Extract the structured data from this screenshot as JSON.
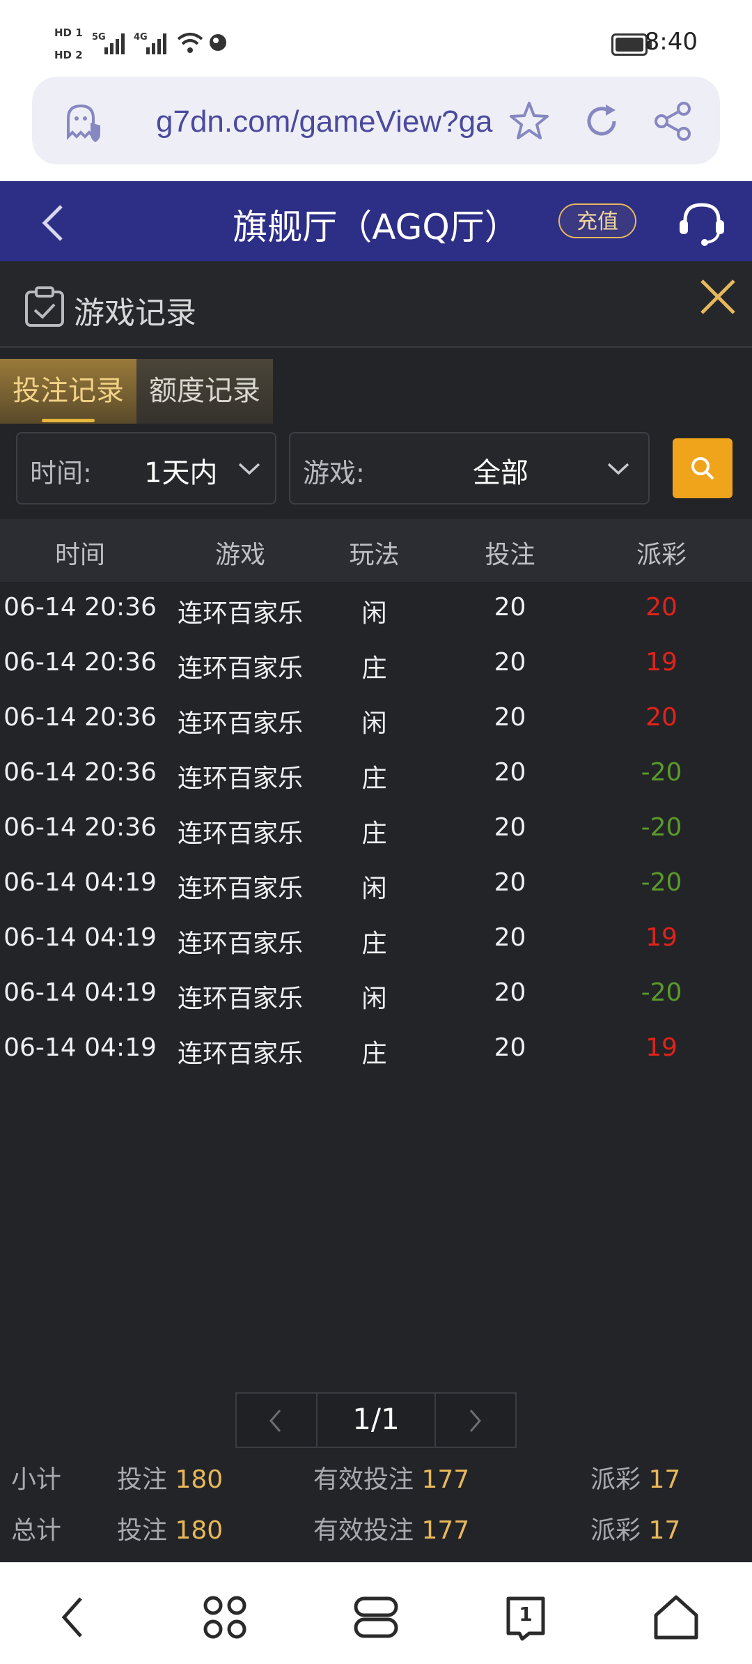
{
  "status_bar": {
    "sim1": "HD 1",
    "sim2": "HD 2",
    "net1": "5G",
    "net2": "4G",
    "time": "8:40"
  },
  "browser": {
    "url": "g7dn.com/gameView?ga"
  },
  "header": {
    "title": "旗舰厅（AGQ厅）",
    "recharge_label": "充值"
  },
  "panel": {
    "title": "游戏记录"
  },
  "tabs": [
    {
      "label": "投注记录",
      "active": true
    },
    {
      "label": "额度记录",
      "active": false
    }
  ],
  "filters": {
    "time_label": "时间:",
    "time_value": "1天内",
    "game_label": "游戏:",
    "game_value": "全部"
  },
  "table": {
    "headers": [
      "时间",
      "游戏",
      "玩法",
      "投注",
      "派彩"
    ],
    "rows": [
      {
        "time": "06-14 20:36",
        "game": "连环百家乐",
        "play": "闲",
        "bet": "20",
        "payout": "20",
        "positive": true
      },
      {
        "time": "06-14 20:36",
        "game": "连环百家乐",
        "play": "庄",
        "bet": "20",
        "payout": "19",
        "positive": true
      },
      {
        "time": "06-14 20:36",
        "game": "连环百家乐",
        "play": "闲",
        "bet": "20",
        "payout": "20",
        "positive": true
      },
      {
        "time": "06-14 20:36",
        "game": "连环百家乐",
        "play": "庄",
        "bet": "20",
        "payout": "-20",
        "positive": false
      },
      {
        "time": "06-14 20:36",
        "game": "连环百家乐",
        "play": "庄",
        "bet": "20",
        "payout": "-20",
        "positive": false
      },
      {
        "time": "06-14 04:19",
        "game": "连环百家乐",
        "play": "闲",
        "bet": "20",
        "payout": "-20",
        "positive": false
      },
      {
        "time": "06-14 04:19",
        "game": "连环百家乐",
        "play": "庄",
        "bet": "20",
        "payout": "19",
        "positive": true
      },
      {
        "time": "06-14 04:19",
        "game": "连环百家乐",
        "play": "闲",
        "bet": "20",
        "payout": "-20",
        "positive": false
      },
      {
        "time": "06-14 04:19",
        "game": "连环百家乐",
        "play": "庄",
        "bet": "20",
        "payout": "19",
        "positive": true
      }
    ]
  },
  "pagination": {
    "page": "1/1"
  },
  "summary": {
    "subtotal": {
      "label": "小计",
      "bet_label": "投注",
      "bet": "180",
      "valid_label": "有效投注",
      "valid": "177",
      "payout_label": "派彩",
      "payout": "17"
    },
    "total": {
      "label": "总计",
      "bet_label": "投注",
      "bet": "180",
      "valid_label": "有效投注",
      "valid": "177",
      "payout_label": "派彩",
      "payout": "17"
    }
  },
  "colors": {
    "header_bg": "#2d2f86",
    "accent_gold": "#e7b85a",
    "search_btn": "#efa41c",
    "payout_positive": "#e0231b",
    "payout_negative": "#5a9a2a"
  },
  "icons": {
    "status": [
      "signal-icon",
      "wifi-icon",
      "battery-icon"
    ],
    "browser": [
      "site-shield-icon",
      "star-icon",
      "refresh-icon",
      "share-icon"
    ],
    "header": [
      "back-icon",
      "customer-service-icon"
    ],
    "panel": [
      "clipboard-check-icon",
      "close-icon"
    ],
    "bottom_nav": [
      "back-icon",
      "apps-icon",
      "tabs-icon",
      "tab-count-icon",
      "home-icon"
    ]
  },
  "bottom_nav": {
    "tab_count": "1"
  }
}
